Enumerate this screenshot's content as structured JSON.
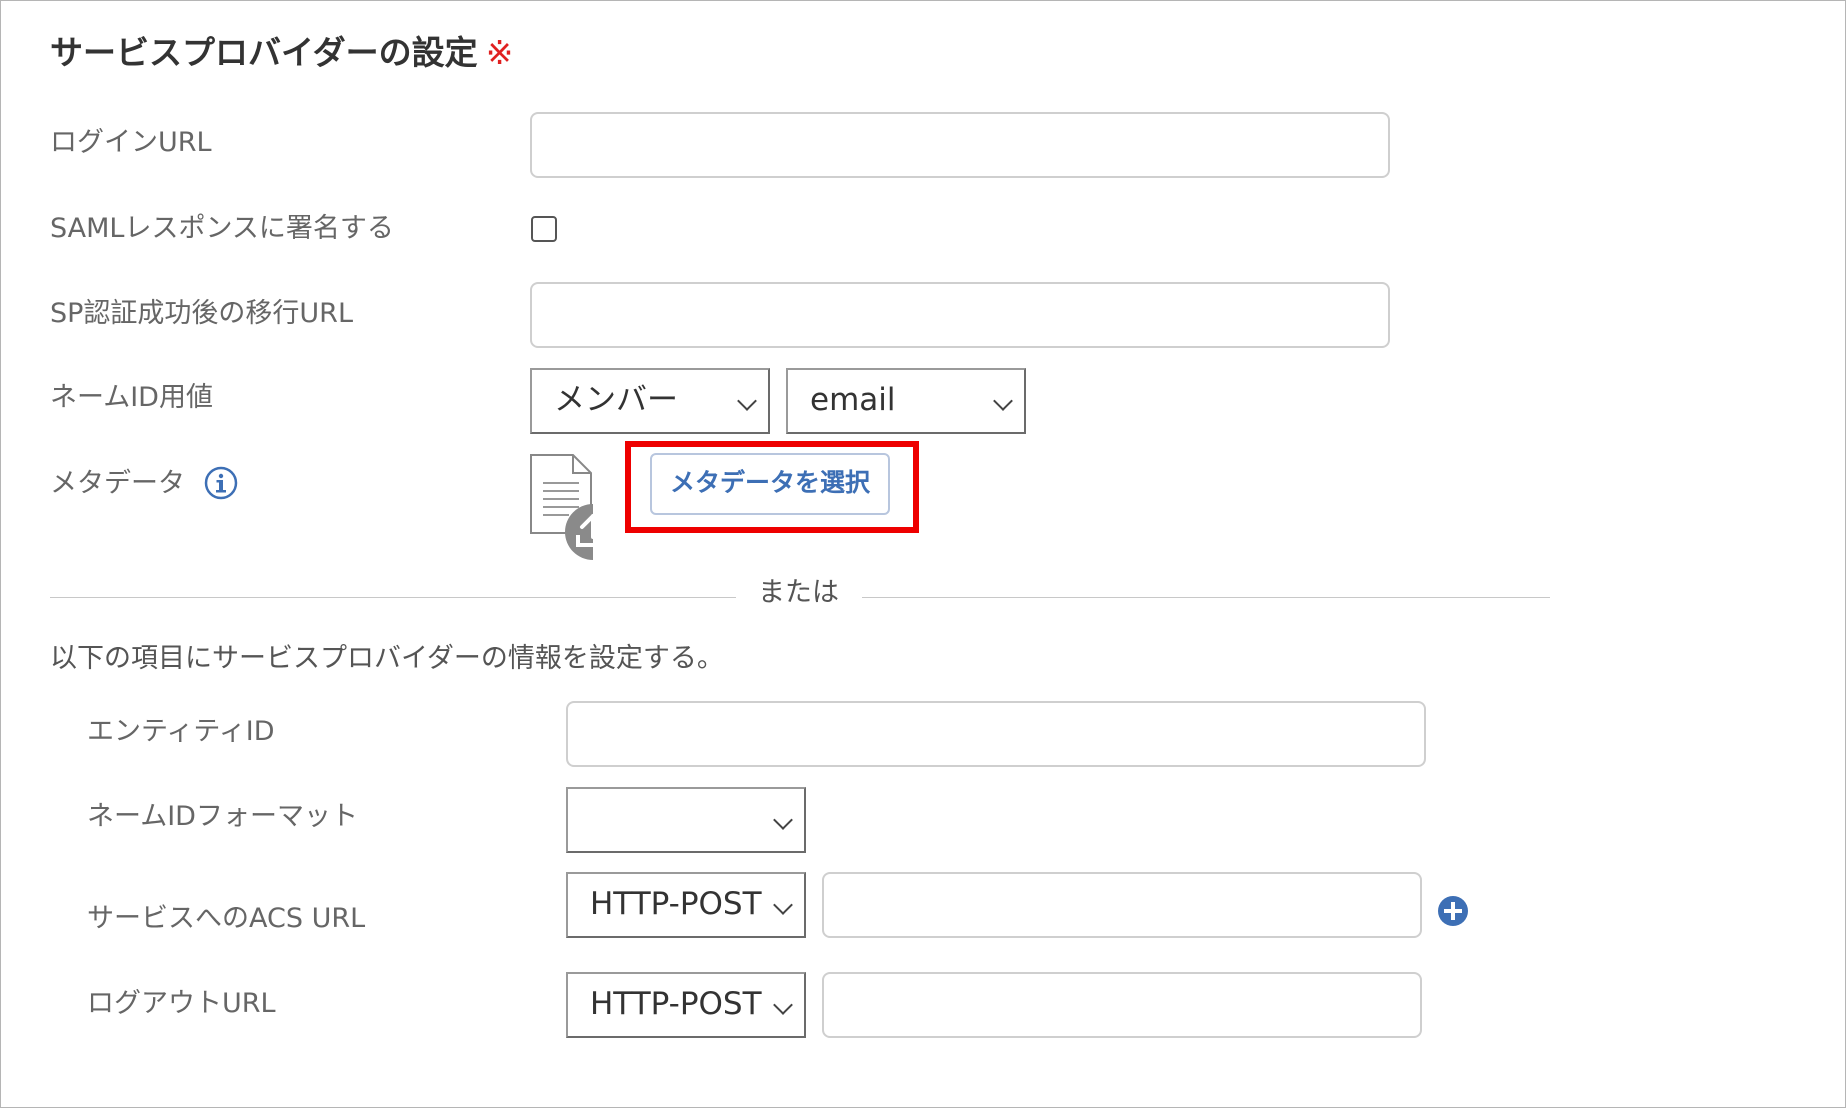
{
  "section": {
    "title": "サービスプロバイダーの設定",
    "required_mark": "※"
  },
  "fields": {
    "login_url": {
      "label": "ログインURL",
      "value": ""
    },
    "sign_saml": {
      "label": "SAMLレスポンスに署名する",
      "checked": false
    },
    "sp_redirect_url": {
      "label": "SP認証成功後の移行URL",
      "value": ""
    },
    "name_id_value": {
      "label": "ネームID用値",
      "select1": "メンバー",
      "select2": "email"
    },
    "metadata": {
      "label": "メタデータ",
      "info_icon": "info-icon",
      "file_icon": "document-upload-icon",
      "button": "メタデータを選択"
    }
  },
  "separator": {
    "text": "または"
  },
  "manual": {
    "description": "以下の項目にサービスプロバイダーの情報を設定する。",
    "entity_id": {
      "label": "エンティティID",
      "value": ""
    },
    "name_id_format": {
      "label": "ネームIDフォーマット",
      "selected": ""
    },
    "acs_url": {
      "label": "サービスへのACS URL",
      "binding": "HTTP-POST",
      "value": "",
      "add_icon": "plus-circle-icon"
    },
    "logout_url": {
      "label": "ログアウトURL",
      "binding": "HTTP-POST",
      "value": ""
    }
  },
  "colors": {
    "highlight": "#ee0000",
    "accent": "#3d6fb5",
    "required": "#e02020"
  }
}
